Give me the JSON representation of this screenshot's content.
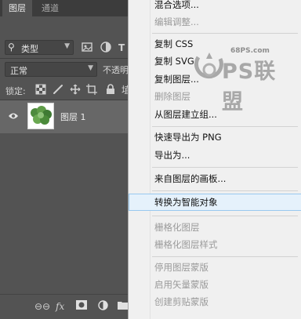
{
  "layers_panel": {
    "tabs": [
      "图层",
      "通道"
    ],
    "filter_kind": "类型",
    "blend_mode": "正常",
    "opacity_label": "不透明",
    "lock_label": "锁定:",
    "layer": {
      "name": "图层 1"
    },
    "bottom_icons": [
      "link-icon",
      "fx-icon",
      "mask-icon",
      "adjustment-icon",
      "folder-icon"
    ],
    "bottom_fx": "fx"
  },
  "context_menu": {
    "items": [
      {
        "label": "混合选项...",
        "enabled": true
      },
      {
        "label": "编辑调整...",
        "enabled": false
      },
      {
        "label": "复制 CSS",
        "enabled": true
      },
      {
        "label": "复制 SVG",
        "enabled": true
      },
      {
        "label": "复制图层...",
        "enabled": true
      },
      {
        "label": "删除图层",
        "enabled": false
      },
      {
        "label": "从图层建立组...",
        "enabled": true
      },
      {
        "label": "快速导出为 PNG",
        "enabled": true
      },
      {
        "label": "导出为...",
        "enabled": true
      },
      {
        "label": "来自图层的画板...",
        "enabled": true
      },
      {
        "label": "转换为智能对象",
        "enabled": true,
        "highlighted": true
      },
      {
        "label": "栅格化图层",
        "enabled": false
      },
      {
        "label": "栅格化图层样式",
        "enabled": false
      },
      {
        "label": "停用图层蒙版",
        "enabled": false
      },
      {
        "label": "启用矢量蒙版",
        "enabled": false
      },
      {
        "label": "创建剪贴蒙版",
        "enabled": false
      }
    ]
  },
  "watermark": {
    "url": "68PS.com",
    "brand": "PS联盟"
  },
  "colors": {
    "panel_bg": "#535353",
    "menu_bg": "#f0f0f0",
    "highlight": "#e5f1fb",
    "highlight_border": "#99c9ef"
  }
}
